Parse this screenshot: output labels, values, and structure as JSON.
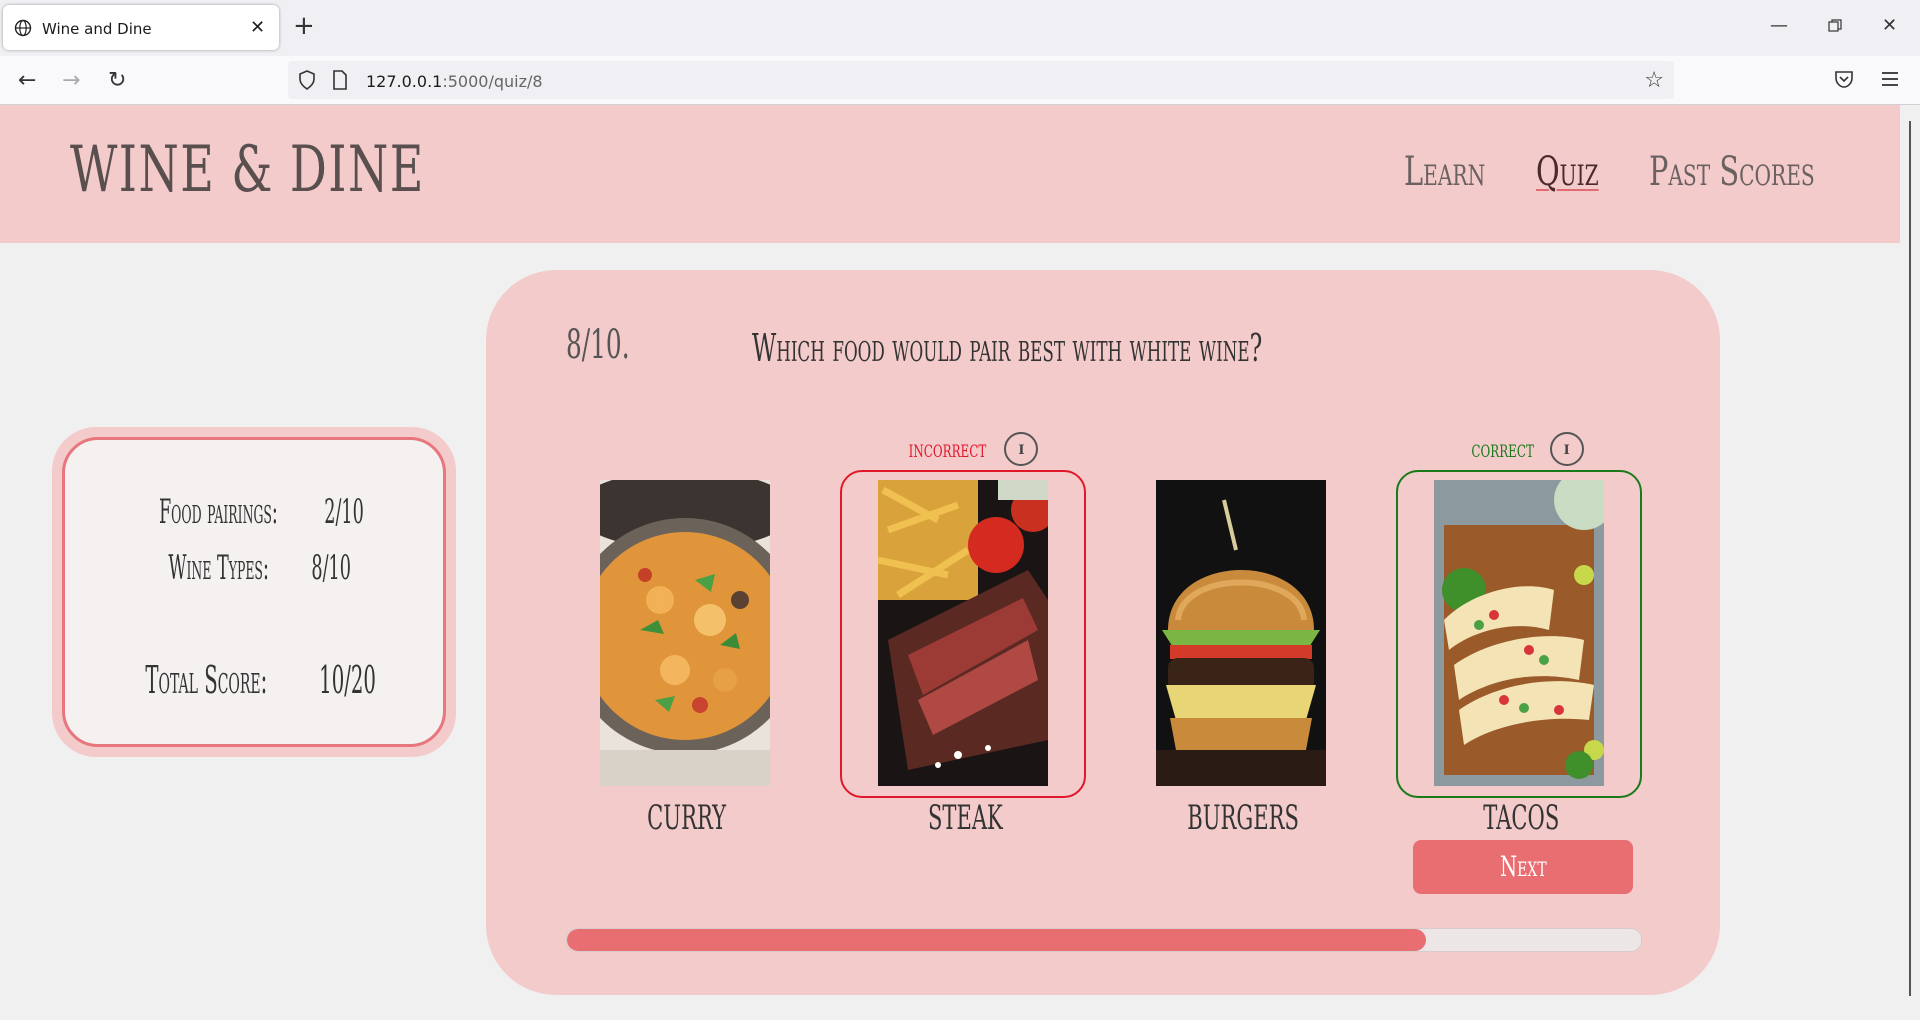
{
  "browser": {
    "tab_title": "Wine and Dine",
    "url_host": "127.0.0.1",
    "url_path": ":5000/quiz/8",
    "icons": [
      "globe-icon",
      "close-icon",
      "plus-icon",
      "back-icon",
      "forward-icon",
      "reload-icon",
      "shield-icon",
      "page-icon",
      "star-icon",
      "pocket-icon",
      "menu-icon",
      "minimize-icon",
      "restore-icon",
      "window-close-icon"
    ]
  },
  "header": {
    "logo": "WINE & DINE",
    "nav": [
      {
        "label": "Learn"
      },
      {
        "label": "Quiz"
      },
      {
        "label": "Past Scores"
      }
    ]
  },
  "scores": {
    "food_label": "Food pairings:",
    "food_value": "2/10",
    "wine_label": "Wine Types:",
    "wine_value": "8/10",
    "total_label": "Total Score:",
    "total_value": "10/20"
  },
  "quiz": {
    "number": "8/10.",
    "question": "Which food would pair best with white wine?",
    "options": [
      {
        "label": "CURRY",
        "feedback": ""
      },
      {
        "label": "STEAK",
        "feedback": "incorrect"
      },
      {
        "label": "BURGERS",
        "feedback": ""
      },
      {
        "label": "TACOS",
        "feedback": "correct"
      }
    ],
    "next_label": "Next",
    "progress": 0.8,
    "colors": {
      "accent": "#e86e72",
      "incorrect": "#e0182a",
      "correct": "#1a7a1a",
      "panel": "#f4cbcb"
    }
  }
}
